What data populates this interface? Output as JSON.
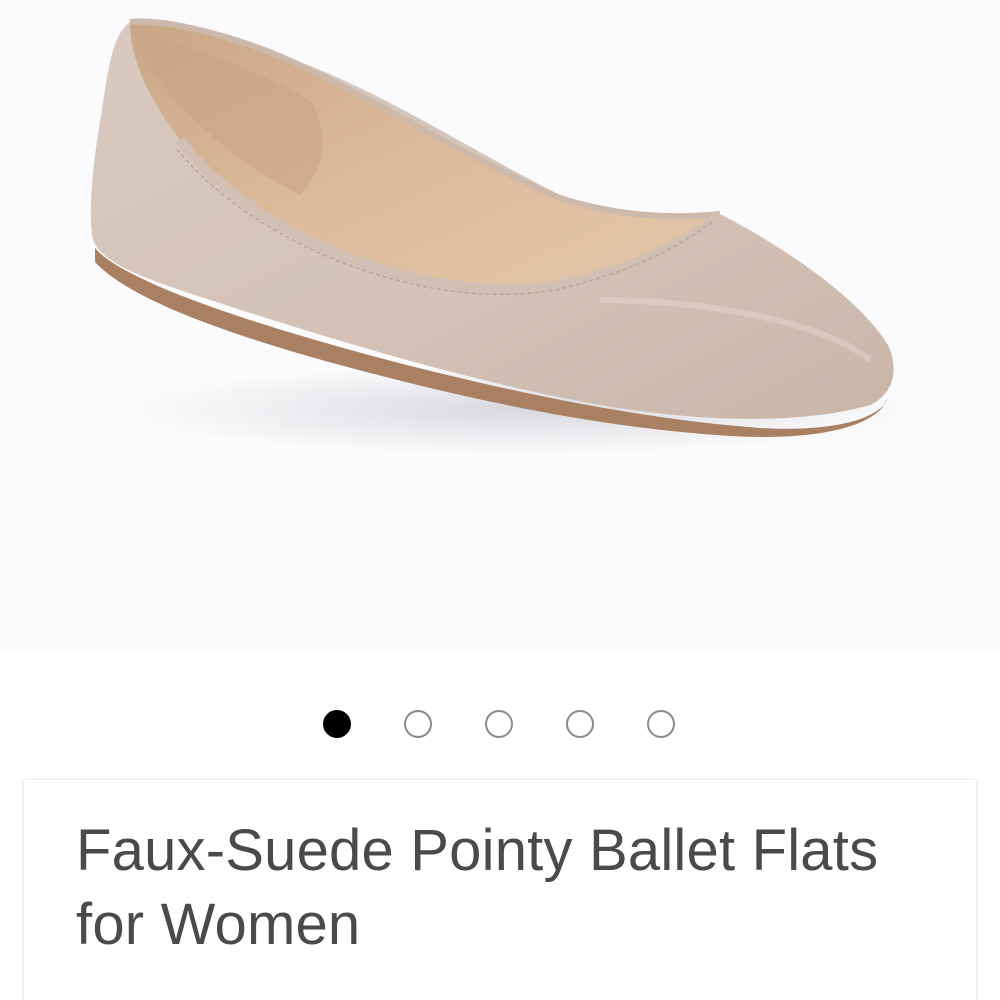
{
  "product_image": {
    "icon": "ballet-flat-shoe-image",
    "colors": {
      "suede": "#d7c6bb",
      "lining": "#d8b596",
      "sole": "#a98062",
      "background": "#fbfbfd"
    }
  },
  "carousel": {
    "total": 5,
    "active_index": 0,
    "colors": {
      "active": "#000000",
      "inactive_border": "#8a8a8a"
    }
  },
  "product": {
    "title": "Faux-Suede Pointy Ballet Flats for Women"
  }
}
